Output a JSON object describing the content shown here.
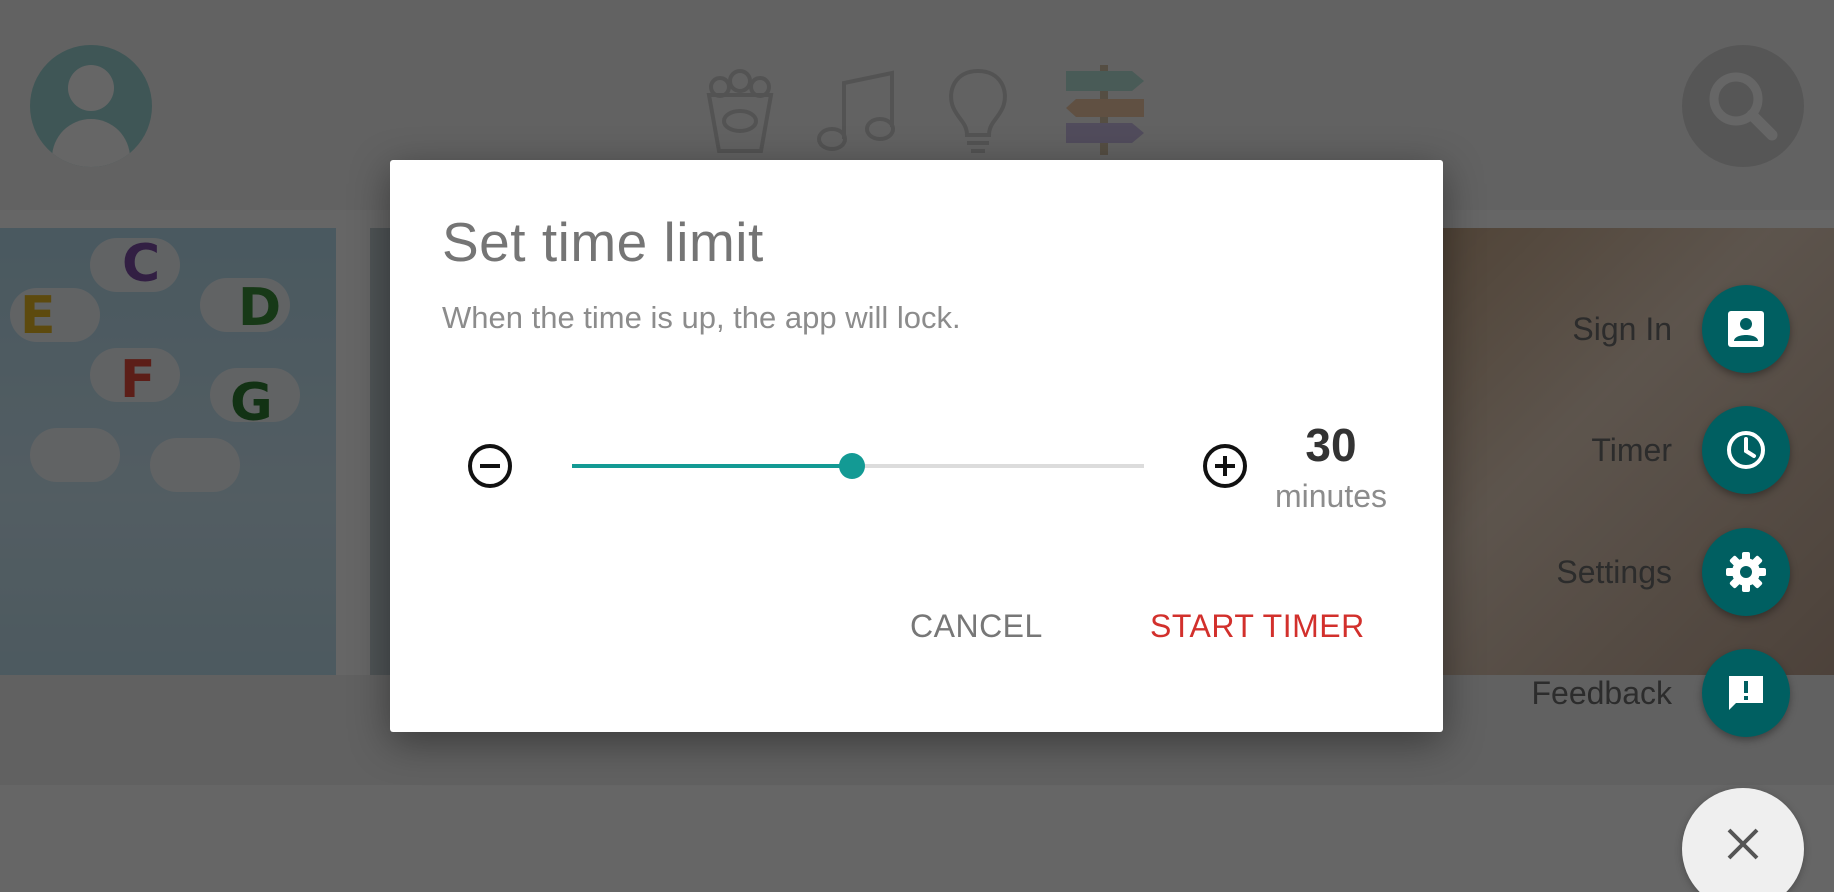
{
  "dialog": {
    "title": "Set time limit",
    "subtitle": "When the time is up, the app will lock.",
    "slider_fraction": 0.49,
    "value": "30",
    "unit": "minutes",
    "cancel_label": "CANCEL",
    "start_label": "START TIMER"
  },
  "fab_menu": {
    "items": [
      {
        "label": "Sign In",
        "icon": "account-box-icon"
      },
      {
        "label": "Timer",
        "icon": "clock-icon"
      },
      {
        "label": "Settings",
        "icon": "gear-icon"
      },
      {
        "label": "Feedback",
        "icon": "feedback-icon"
      }
    ],
    "close_icon": "close-icon"
  },
  "background": {
    "category_icons": [
      "popcorn-icon",
      "music-note-icon",
      "lightbulb-icon",
      "signpost-icon"
    ]
  },
  "colors": {
    "accent": "#139a94",
    "fab": "#005f61",
    "start_button": "#d2302c",
    "scrim": "rgba(0,0,0,0.6)"
  }
}
